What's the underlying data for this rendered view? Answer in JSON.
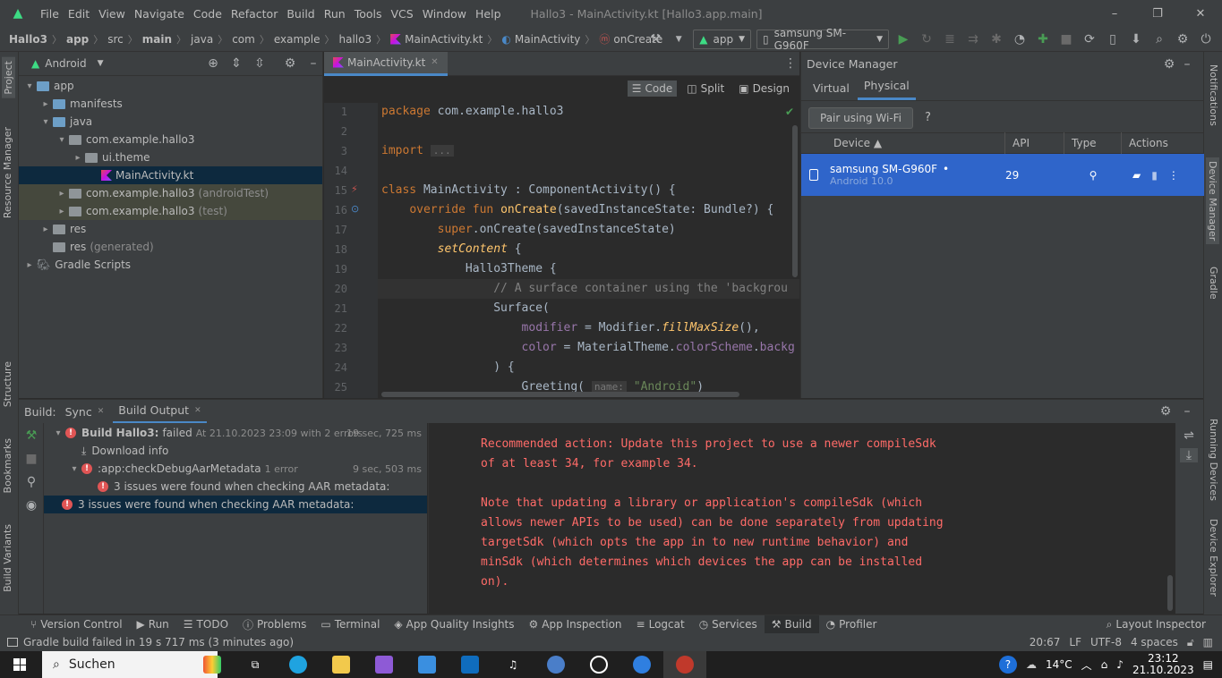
{
  "menubar": {
    "items": [
      "File",
      "Edit",
      "View",
      "Navigate",
      "Code",
      "Refactor",
      "Build",
      "Run",
      "Tools",
      "VCS",
      "Window",
      "Help"
    ],
    "title": "Hallo3 - MainActivity.kt [Hallo3.app.main]"
  },
  "navbar": {
    "crumbs": [
      "Hallo3",
      "app",
      "src",
      "main",
      "java",
      "com",
      "example",
      "hallo3",
      "MainActivity.kt",
      "MainActivity",
      "onCreate"
    ],
    "run_config": "app",
    "device": "samsung SM-G960F"
  },
  "left_strip": {
    "project": "Project",
    "resource_manager": "Resource Manager",
    "structure": "Structure",
    "bookmarks": "Bookmarks",
    "build_variants": "Build Variants"
  },
  "right_strip": {
    "notifications": "Notifications",
    "device_manager": "Device Manager",
    "gradle": "Gradle",
    "running_devices": "Running Devices",
    "device_explorer": "Device Explorer"
  },
  "project": {
    "view": "Android",
    "tree": [
      {
        "label": "app",
        "suffix": "",
        "indent": 0,
        "arrow": "▾",
        "icon": "folder-blue"
      },
      {
        "label": "manifests",
        "suffix": "",
        "indent": 1,
        "arrow": "▸",
        "icon": "folder-blue"
      },
      {
        "label": "java",
        "suffix": "",
        "indent": 1,
        "arrow": "▾",
        "icon": "folder-blue"
      },
      {
        "label": "com.example.hallo3",
        "suffix": "",
        "indent": 2,
        "arrow": "▾",
        "icon": "folder-gray"
      },
      {
        "label": "ui.theme",
        "suffix": "",
        "indent": 3,
        "arrow": "▸",
        "icon": "folder-gray"
      },
      {
        "label": "MainActivity.kt",
        "suffix": "",
        "indent": 4,
        "arrow": "",
        "icon": "kotlin",
        "state": "sel"
      },
      {
        "label": "com.example.hallo3",
        "suffix": "(androidTest)",
        "indent": 2,
        "arrow": "▸",
        "icon": "folder-gray",
        "state": "hl"
      },
      {
        "label": "com.example.hallo3",
        "suffix": "(test)",
        "indent": 2,
        "arrow": "▸",
        "icon": "folder-gray",
        "state": "hl"
      },
      {
        "label": "res",
        "suffix": "",
        "indent": 1,
        "arrow": "▸",
        "icon": "folder-gray"
      },
      {
        "label": "res",
        "suffix": "(generated)",
        "indent": 1,
        "arrow": "",
        "icon": "folder-gray"
      },
      {
        "label": "Gradle Scripts",
        "suffix": "",
        "indent": 0,
        "arrow": "▸",
        "icon": "gradle"
      }
    ]
  },
  "editor": {
    "tab": "MainActivity.kt",
    "modes": [
      "Code",
      "Split",
      "Design"
    ],
    "line_numbers": [
      "1",
      "2",
      "3",
      "14",
      "15",
      "16",
      "17",
      "18",
      "19",
      "20",
      "21",
      "22",
      "23",
      "24",
      "25"
    ]
  },
  "device_manager": {
    "title": "Device Manager",
    "tabs": [
      "Virtual",
      "Physical"
    ],
    "pair_button": "Pair using Wi-Fi",
    "help": "?",
    "columns": [
      "Device ▲",
      "API",
      "Type",
      "Actions"
    ],
    "device": {
      "name": "samsung SM-G960F",
      "status_dot": "•",
      "os": "Android 10.0",
      "api": "29"
    }
  },
  "build": {
    "label": "Build:",
    "tabs": [
      "Sync",
      "Build Output"
    ],
    "tree": [
      {
        "text": "Build Hallo3:",
        "strong": true,
        "extra": "failed",
        "extra2": "At 21.10.2023 23:09 with 2 errors",
        "time": "19 sec, 725 ms",
        "indent": 0,
        "arrow": "▾",
        "icon": "error"
      },
      {
        "text": "Download info",
        "extra": "",
        "extra2": "",
        "time": "",
        "indent": 1,
        "arrow": "",
        "icon": "download"
      },
      {
        "text": ":app:checkDebugAarMetadata",
        "extra": "",
        "extra2": "1 error",
        "time": "9 sec, 503 ms",
        "indent": 1,
        "arrow": "▾",
        "icon": "error"
      },
      {
        "text": "3 issues were found when checking AAR metadata:",
        "extra": "",
        "extra2": "",
        "time": "",
        "indent": 2,
        "arrow": "",
        "icon": "error"
      },
      {
        "text": "3 issues were found when checking AAR metadata:",
        "extra": "",
        "extra2": "",
        "time": "",
        "indent": -1,
        "arrow": "",
        "icon": "error",
        "state": "sel"
      }
    ],
    "output": [
      "Recommended action: Update this project to use a newer compileSdk",
      "of at least 34, for example 34.",
      "",
      "Note that updating a library or application's compileSdk (which",
      "allows newer APIs to be used) can be done separately from updating",
      "targetSdk (which opts the app in to new runtime behavior) and",
      "minSdk (which determines which devices the app can be installed",
      "on)."
    ]
  },
  "toolwindows": {
    "left": [
      "Version Control",
      "Run",
      "TODO",
      "Problems",
      "Terminal",
      "App Quality Insights",
      "App Inspection",
      "Logcat",
      "Services",
      "Build",
      "Profiler"
    ],
    "right": "Layout Inspector"
  },
  "status": {
    "message": "Gradle build failed in 19 s 717 ms (3 minutes ago)",
    "position": "20:67",
    "line_sep": "LF",
    "encoding": "UTF-8",
    "indent": "4 spaces"
  },
  "taskbar": {
    "search": "Suchen",
    "temp": "14°C",
    "time": "23:12",
    "date": "21.10.2023"
  },
  "colors": {
    "accent": "#4a88c7",
    "selection": "#2f65ca",
    "error": "#ff6b68"
  }
}
